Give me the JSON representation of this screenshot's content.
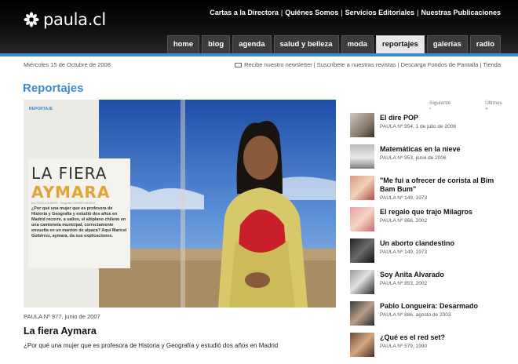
{
  "site": {
    "logo_text": "paula.cl"
  },
  "top_links": [
    "Cartas a la Directora",
    "Quiénes Somos",
    "Servicios Editoriales",
    "Nuestras Publicaciones"
  ],
  "nav": {
    "tabs": [
      "home",
      "blog",
      "agenda",
      "salud y belleza",
      "moda",
      "reportajes",
      "galerías",
      "radio"
    ],
    "active": "reportajes"
  },
  "date": "Miércoles 15 de Octubre de 2008",
  "util_links": [
    "Recibe nuestro newsletter",
    "Suscríbete a nuestras revistas",
    "Descarga Fondos de Pantalla",
    "Tienda"
  ],
  "section_title": "Reportajes",
  "pager": {
    "next": "Siguiente",
    "last": "Últimos"
  },
  "feature": {
    "tag": "REPORTAJE",
    "headline_1": "LA FIERA",
    "headline_2": "AYMARA",
    "byline": "por CAMILA ALBERS · fotografía CARMEN MUÑOZ",
    "lede": "¿Por qué una mujer que es profesora de Historia y Geografía y estudió dos años en Madrid recorre, a saltos, el altiplano chileno en una camioneta municipal, correctamente envuelta en un mantón de alpaca? Aquí Maricel Gutiérrez, aymara, da sus explicaciones.",
    "meta": "PAULA Nº 977, junio de 2007",
    "title": "La fiera Aymara",
    "description": "¿Por qué una mujer que es profesora de Historia y Geografía y estudió dos años en Madrid"
  },
  "articles": [
    {
      "title": "El dire POP",
      "meta": "PAULA Nº 954, 1 de julio de 2006"
    },
    {
      "title": "Matemáticas en la nieve",
      "meta": "PAULA Nº 953, junio de 2006"
    },
    {
      "title": "\"Me fui a ofrecer de corista al Bim Bam Bum\"",
      "meta": "PAULA Nº 149, 1973"
    },
    {
      "title": "El regalo que trajo Milagros",
      "meta": "PAULA Nº 866, 2002"
    },
    {
      "title": "Un aborto clandestino",
      "meta": "PAULA Nº 149, 1973"
    },
    {
      "title": "Soy Anita Alvarado",
      "meta": "PAULA Nº 853, 2002"
    },
    {
      "title": "Pablo Longueira: Desarmado",
      "meta": "PAULA Nº 886, agosto de 2003"
    },
    {
      "title": "¿Qué es el red set?",
      "meta": "PAULA Nº 579, 1990"
    }
  ]
}
